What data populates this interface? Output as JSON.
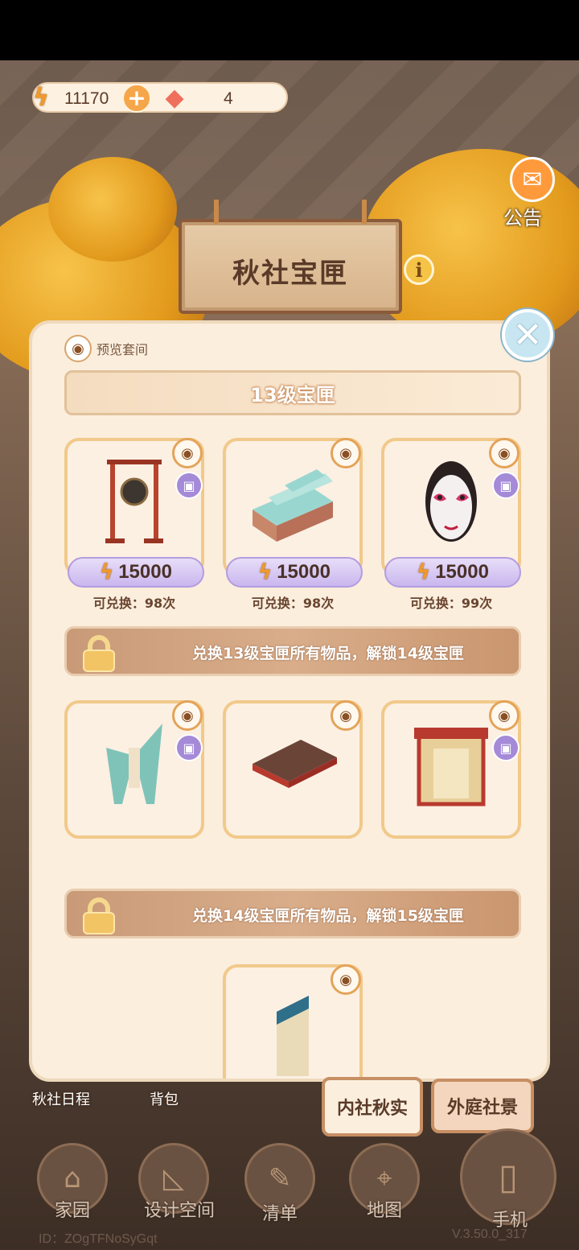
{
  "currency": {
    "energy": "11170",
    "gems": "4",
    "energy_icon": "lightning-icon",
    "gem_icon": "diamond-icon"
  },
  "notice": {
    "label": "公告"
  },
  "header": {
    "title": "秋社宝匣"
  },
  "panel": {
    "preview_label": "预览套间",
    "level_banner": "13级宝匣",
    "row1": [
      {
        "name": "gong",
        "price": "15000",
        "remain": "可兑换：98次"
      },
      {
        "name": "stairs",
        "price": "15000",
        "remain": "可兑换：98次"
      },
      {
        "name": "opera-mask",
        "price": "15000",
        "remain": "可兑换：99次"
      }
    ],
    "lock1_text": "兑换13级宝匣所有物品，解锁14级宝匣",
    "lock2_text": "兑换14级宝匣所有物品，解锁15级宝匣"
  },
  "tabs": {
    "inner": "内社秋实",
    "outer": "外庭社景"
  },
  "side": {
    "schedule": "秋社日程",
    "bag": "背包"
  },
  "nav": {
    "home": "家园",
    "design": "设计空间",
    "list": "清单",
    "map": "地图",
    "phone": "手机"
  },
  "footer": {
    "id": "ID：ZOgTFNoSyGqt",
    "version": "V.3.50.0_317"
  },
  "colors": {
    "panel_bg": "#fbeedd",
    "card_border": "#f1c98a",
    "price_pill": "#c9b6ee",
    "lock_banner": "#c99a78",
    "accent_orange": "#f09a2a"
  }
}
